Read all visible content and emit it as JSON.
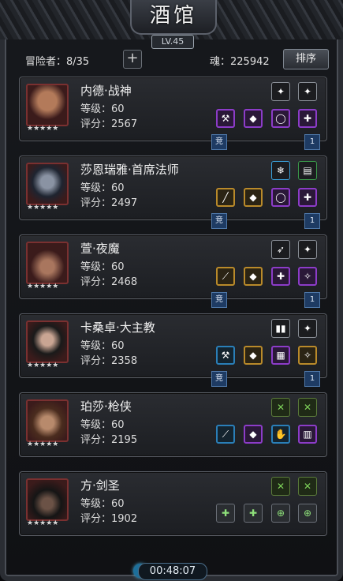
{
  "title": "酒馆",
  "level": "LV.45",
  "adventurers_label": "冒险者：8/35",
  "souls_label": "魂：225942",
  "sort_label": "排序",
  "timer": "00:48:07",
  "stars": "★★★★★",
  "heroes": [
    {
      "name": "内德·战神",
      "level": "等级：60",
      "score": "评分：2567",
      "tab_left": "竞",
      "tab_right": "1"
    },
    {
      "name": "莎恩瑞雅·首席法师",
      "level": "等级：60",
      "score": "评分：2497",
      "tab_left": "竞",
      "tab_right": "1"
    },
    {
      "name": "萱·夜魔",
      "level": "等级：60",
      "score": "评分：2468",
      "tab_left": "竞",
      "tab_right": "1"
    },
    {
      "name": "卡桑卓·大主教",
      "level": "等级：60",
      "score": "评分：2358",
      "tab_left": "竞",
      "tab_right": "1"
    },
    {
      "name": "珀莎·枪侠",
      "level": "等级：60",
      "score": "评分：2195"
    },
    {
      "name": "方·剑圣",
      "level": "等级：60",
      "score": "评分：1902"
    }
  ]
}
